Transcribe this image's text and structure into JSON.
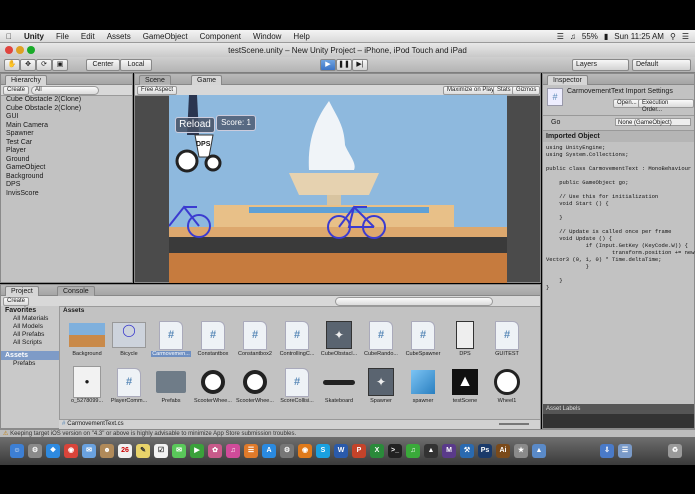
{
  "menubar": {
    "items": [
      "Unity",
      "File",
      "Edit",
      "Assets",
      "GameObject",
      "Component",
      "Window",
      "Help"
    ],
    "battery": "55%",
    "clock": "Sun 11:25 AM"
  },
  "window_title": "testScene.unity – New Unity Project – iPhone, iPod Touch and iPad",
  "toolbar": {
    "center_label": "Center",
    "local_label": "Local",
    "layers_label": "Layers",
    "layout_label": "Default"
  },
  "hierarchy": {
    "tab": "Hierarchy",
    "create": "Create",
    "search": "All",
    "items": [
      "Cube Obstacle 2(Clone)",
      "Cube Obstacle 2(Clone)",
      "GUI",
      "Main Camera",
      "Spawner",
      "Test Car",
      "Player",
      "Ground",
      "GameObject",
      "Background",
      "DPS",
      "InvisScore"
    ]
  },
  "scene_tabs": {
    "scene": "Scene",
    "game": "Game",
    "aspect": "Free Aspect",
    "maximize": "Maximize on Play",
    "stats": "Stats",
    "gizmos": "Gizmos"
  },
  "game_view": {
    "reload": "Reload",
    "score": "Score: 1",
    "dps": "DPS"
  },
  "inspector": {
    "tab": "Inspector",
    "asset_title": "CarmovementText Import Settings",
    "open_button": "Open...",
    "exec_button": "Execution Order...",
    "go_label": "Go",
    "go_value": "None (GameObject)",
    "imported_label": "Imported Object",
    "code": "using UnityEngine;\nusing System.Collections;\n\npublic class CarmovementText : MonoBehaviour {\n\n    public GameObject go;\n\n    // Use this for initialization\n    void Start () {\n\n    }\n\n    // Update is called once per frame\n    void Update () {\n            if (Input.GetKey (KeyCode.W)) {\n                    transform.position += new\nVector3 (0, 1, 0) * Time.deltaTime;\n            }\n\n    }\n}",
    "asset_labels": "Asset Labels"
  },
  "project": {
    "tab_project": "Project",
    "tab_console": "Console",
    "create": "Create",
    "favorites": "Favorites",
    "fav_items": [
      "All Materials",
      "All Models",
      "All Prefabs",
      "All Scripts"
    ],
    "assets_root": "Assets",
    "folders": [
      "Prefabs"
    ],
    "breadcrumb": "Assets",
    "assets_row1": [
      "Background",
      "Bicycle",
      "Carmovemen...",
      "Constantbox",
      "Constantbox2",
      "ControllingC...",
      "CubeObstacl...",
      "CubeRando...",
      "CubeSpawner",
      "DPS",
      "GUITEST"
    ],
    "assets_row2": [
      "o_5278099...",
      "PlayerComm...",
      "Prefabs",
      "ScooterWhee...",
      "ScooterWhee...",
      "ScoreCollisi...",
      "Skateboard",
      "Spawner",
      "spawner",
      "testScene",
      "Wheel1"
    ],
    "selected_file": "CarmovementText.cs"
  },
  "status": "Keeping target iOS version on \"4.3\" or above is highly advisable to minimize App Store submission troubles.",
  "colors": {
    "sky": "#8eb9de",
    "sand": "#e8c088",
    "ground": "#c67b3e",
    "road": "#3a3a3a",
    "unity_dark": "#c2c2c2"
  }
}
